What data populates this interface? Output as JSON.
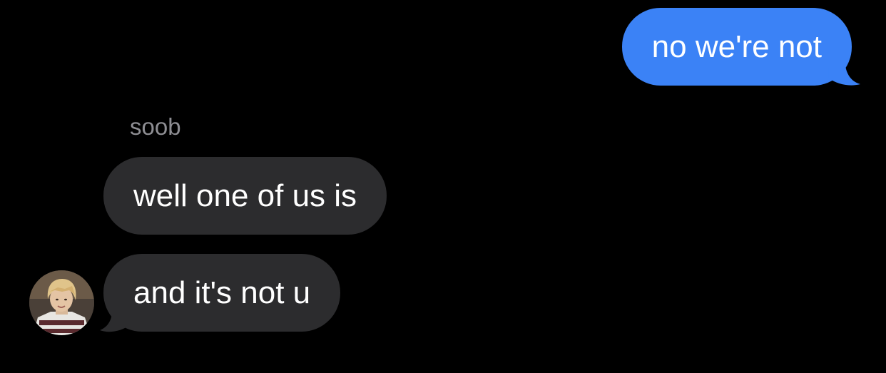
{
  "conversation": {
    "messages": [
      {
        "direction": "outgoing",
        "text": "no we're not",
        "color": "#3B82F6"
      },
      {
        "direction": "incoming",
        "sender": "soob",
        "text": "well one of us is",
        "color": "#2C2C2E"
      },
      {
        "direction": "incoming",
        "sender": "soob",
        "text": "and it's not u",
        "color": "#2C2C2E",
        "avatar": "contact-photo"
      }
    ]
  },
  "colors": {
    "background": "#000000",
    "outgoing_bubble": "#3B82F6",
    "incoming_bubble": "#2C2C2E",
    "sender_name": "#8E8E93",
    "message_text": "#FFFFFF"
  }
}
